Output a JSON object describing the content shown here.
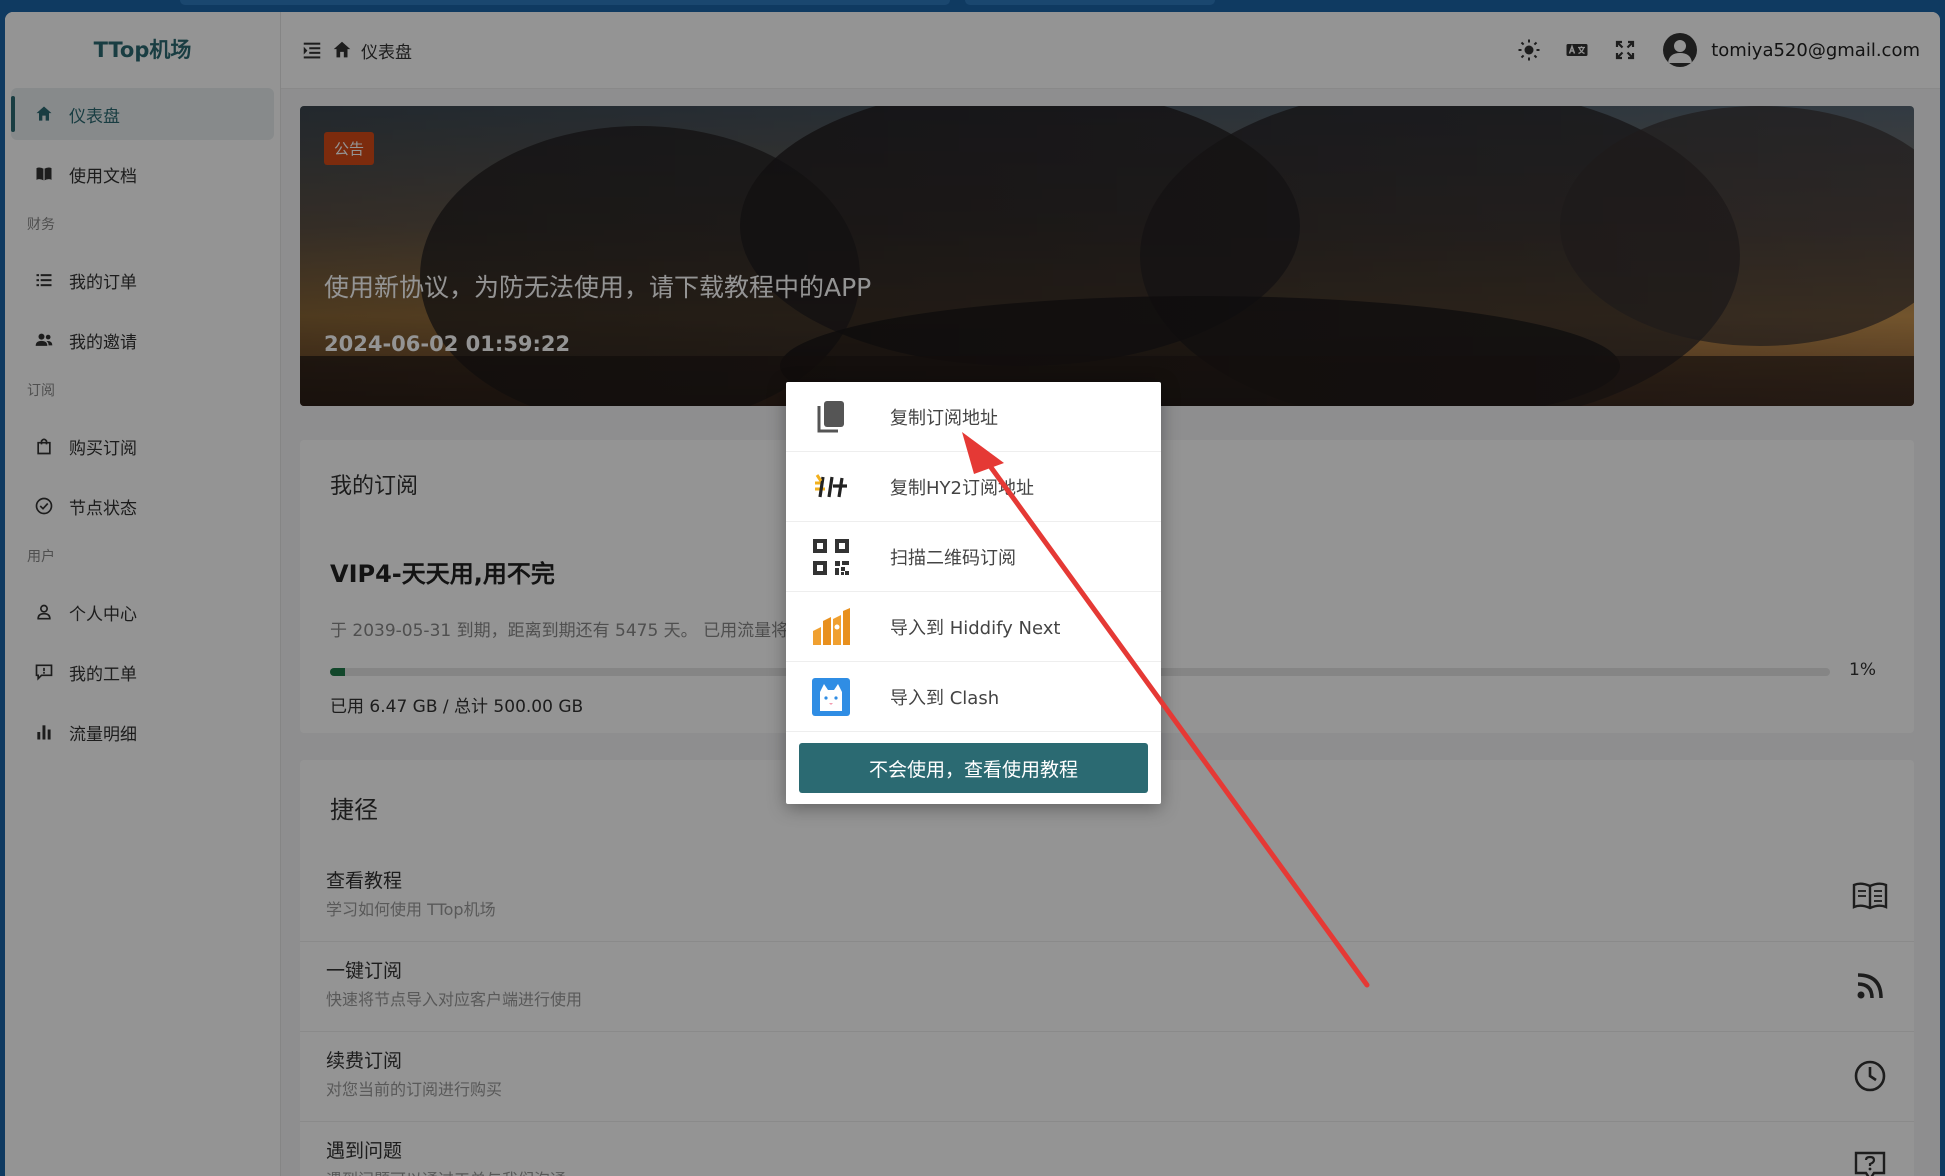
{
  "app": {
    "logo": "TTop机场"
  },
  "header": {
    "breadcrumb": "仪表盘",
    "user_email": "tomiya520@gmail.com"
  },
  "sidebar": {
    "items": [
      {
        "label": "仪表盘",
        "icon": "home-icon",
        "active": true
      },
      {
        "label": "使用文档",
        "icon": "book-icon"
      },
      {
        "group": "财务"
      },
      {
        "label": "我的订单",
        "icon": "list-icon"
      },
      {
        "label": "我的邀请",
        "icon": "users-icon"
      },
      {
        "group": "订阅"
      },
      {
        "label": "购买订阅",
        "icon": "bag-icon"
      },
      {
        "label": "节点状态",
        "icon": "check-circle-icon"
      },
      {
        "group": "用户"
      },
      {
        "label": "个人中心",
        "icon": "user-icon"
      },
      {
        "label": "我的工单",
        "icon": "ticket-icon"
      },
      {
        "label": "流量明细",
        "icon": "bar-chart-icon"
      }
    ]
  },
  "announcement": {
    "tag": "公告",
    "title": "使用新协议，为防无法使用，请下载教程中的APP",
    "date": "2024-06-02 01:59:22"
  },
  "subscription": {
    "heading": "我的订阅",
    "plan": "VIP4-天天用,用不完",
    "expiry_text": "于 2039-05-31 到期，距离到期还有 5475 天。 已用流量将",
    "percent": "1%",
    "percent_value": 1,
    "used_text": "已用 6.47 GB / 总计 500.00 GB"
  },
  "shortcuts": {
    "heading": "捷径",
    "items": [
      {
        "title": "查看教程",
        "desc": "学习如何使用 TTop机场",
        "icon": "book-open-icon"
      },
      {
        "title": "一键订阅",
        "desc": "快速将节点导入对应客户端进行使用",
        "icon": "rss-icon"
      },
      {
        "title": "续费订阅",
        "desc": "对您当前的订阅进行购买",
        "icon": "clock-icon"
      },
      {
        "title": "遇到问题",
        "desc": "遇到问题可以通过工单与我们沟通",
        "icon": "help-message-icon"
      }
    ]
  },
  "popup": {
    "items": [
      {
        "label": "复制订阅地址",
        "icon": "copy-icon"
      },
      {
        "label": "复制HY2订阅地址",
        "icon": "hysteria-icon"
      },
      {
        "label": "扫描二维码订阅",
        "icon": "qr-code-icon"
      },
      {
        "label": "导入到 Hiddify Next",
        "icon": "hiddify-icon"
      },
      {
        "label": "导入到 Clash",
        "icon": "clash-cat-icon"
      }
    ],
    "button": "不会使用，查看使用教程"
  },
  "colors": {
    "primary": "#2b6a72",
    "tag": "#d64a17",
    "progress": "#1f7a4a",
    "arrow": "#e53935",
    "desktop": "#1a64a8"
  }
}
